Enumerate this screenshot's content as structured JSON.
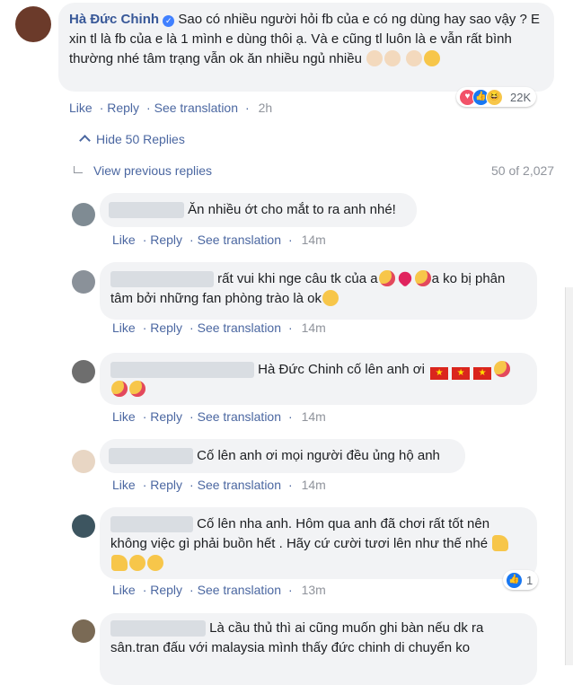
{
  "post_comment": {
    "author": "Hà Đức Chinh",
    "text": "Sao có nhiều người hỏi fb của e có ng dùng hay sao vậy ? E xin tl là fb của e là 1 mình e dùng thôi ạ. Và e cũng tl luôn là e vẫn rất bình thường nhé tâm trạng vẫn ok ăn nhiều ngủ nhiều",
    "actions": {
      "like": "Like",
      "reply": "Reply",
      "translate": "See translation",
      "time": "2h"
    },
    "reactions_count": "22K",
    "reaction_icons": [
      "heart-icon",
      "like-icon",
      "haha-icon"
    ]
  },
  "hide_replies": "Hide 50 Replies",
  "view_previous": "View previous replies",
  "replies_count": "50 of 2,027",
  "replies": [
    {
      "text": "Ăn nhiều ớt cho mắt to ra anh nhé!",
      "time": "14m"
    },
    {
      "text_a": "rất vui khi nge câu tk của a",
      "text_b": "a ko bị phân tâm bởi những fan phòng trào là ok",
      "time": "14m"
    },
    {
      "name_fragment": "Hà Đức Chinh cố lên anh ơi",
      "time": "14m"
    },
    {
      "text": "Cố lên anh ơi mọi người đều ủng hộ anh",
      "time": "14m"
    },
    {
      "text": "Cố lên nha anh. Hôm qua anh đã chơi rất tốt nên không việc gì phải buồn hết . Hãy cứ cười tươi lên như thế nhé",
      "time": "13m",
      "reactions_count": "1"
    },
    {
      "text": "Là cầu thủ thì ai cũng muốn ghi bàn nếu dk ra sân.tran đấu với malaysia mình thấy đức chinh di chuyển ko"
    }
  ],
  "labels": {
    "like": "Like",
    "reply": "Reply",
    "translate": "See translation"
  }
}
